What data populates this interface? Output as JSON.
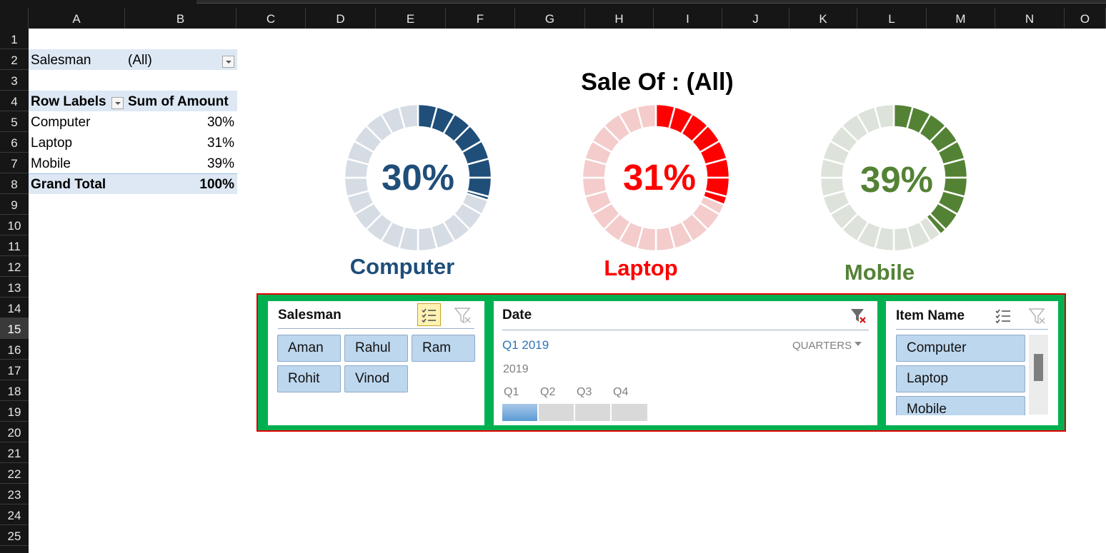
{
  "sheet": {
    "columns": [
      "A",
      "B",
      "C",
      "D",
      "E",
      "F",
      "G",
      "H",
      "I",
      "J",
      "K",
      "L",
      "M",
      "N",
      "O"
    ],
    "rows": [
      "1",
      "2",
      "3",
      "4",
      "5",
      "6",
      "7",
      "8",
      "9",
      "10",
      "11",
      "12",
      "13",
      "14",
      "15",
      "16",
      "17",
      "18",
      "19",
      "20",
      "21",
      "22",
      "23",
      "24",
      "25"
    ],
    "selected_row": "15"
  },
  "pivot": {
    "filter_label": "Salesman",
    "filter_value": "(All)",
    "header_row_labels": "Row Labels",
    "header_sum": "Sum of Amount",
    "rows": [
      {
        "label": "Computer",
        "value": "30%"
      },
      {
        "label": "Laptop",
        "value": "31%"
      },
      {
        "label": "Mobile",
        "value": "39%"
      }
    ],
    "total_label": "Grand Total",
    "total_value": "100%"
  },
  "dashboard": {
    "title": "Sale Of  : (All)",
    "gauges": [
      {
        "label": "Computer",
        "pct_text": "30%",
        "value": 0.3,
        "color": "#1f4e79",
        "track": "#d6dce4"
      },
      {
        "label": "Laptop",
        "pct_text": "31%",
        "value": 0.31,
        "color": "#ff0000",
        "track": "#f4cccc"
      },
      {
        "label": "Mobile",
        "pct_text": "39%",
        "value": 0.39,
        "color": "#548235",
        "track": "#dde3db"
      }
    ]
  },
  "slicers": {
    "salesman": {
      "title": "Salesman",
      "items": [
        "Aman",
        "Rahul",
        "Ram",
        "Rohit",
        "Vinod"
      ]
    },
    "date": {
      "title": "Date",
      "selection": "Q1 2019",
      "level": "QUARTERS",
      "year": "2019",
      "quarters": [
        "Q1",
        "Q2",
        "Q3",
        "Q4"
      ],
      "selected_quarter": "Q1"
    },
    "item": {
      "title": "Item Name",
      "items": [
        "Computer",
        "Laptop",
        "Mobile"
      ]
    }
  },
  "icons": {
    "multiselect": "multi-select-icon",
    "clear_filter": "clear-filter-icon",
    "dropdown": "chevron-down-icon"
  }
}
